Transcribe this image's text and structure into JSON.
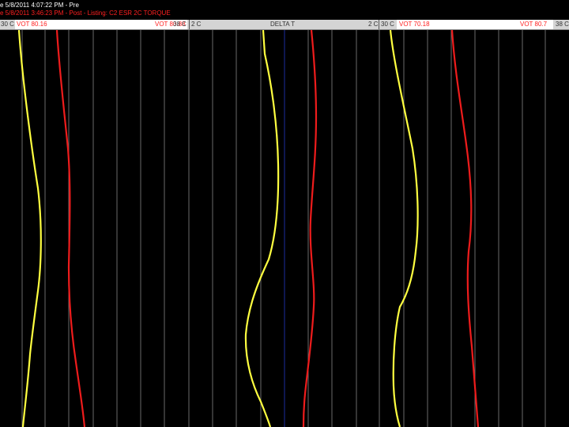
{
  "info": {
    "line1": "e 5/8/2011 4:07:22 PM - Pre",
    "line2": "e 5/8/2011 3:46:23 PM - Post - Listing: C2 ESR 2C TORQUE"
  },
  "header": {
    "track1_left": "30 C",
    "track1_name": "VOT 80.16",
    "track1_value": "VOT 80.88",
    "track1_right": "38 C",
    "track2_left": "2 C",
    "track2_name": "DELTA T",
    "track2_right": "2 C",
    "track3_left": "30 C",
    "track3_name": "VOT 70.18",
    "track3_value": "VOT 80.7",
    "track3_right": "38 C"
  },
  "colors": {
    "background": "#000000",
    "grid": "#6a6a6a",
    "pre_curve": "#ffff40",
    "post_curve": "#ee1c1c",
    "center_line": "#1c2e9e",
    "header_bar": "#d4d4d4",
    "info_red": "#ff2020"
  },
  "legend": {
    "pre": "Pre",
    "post": "Post"
  }
}
